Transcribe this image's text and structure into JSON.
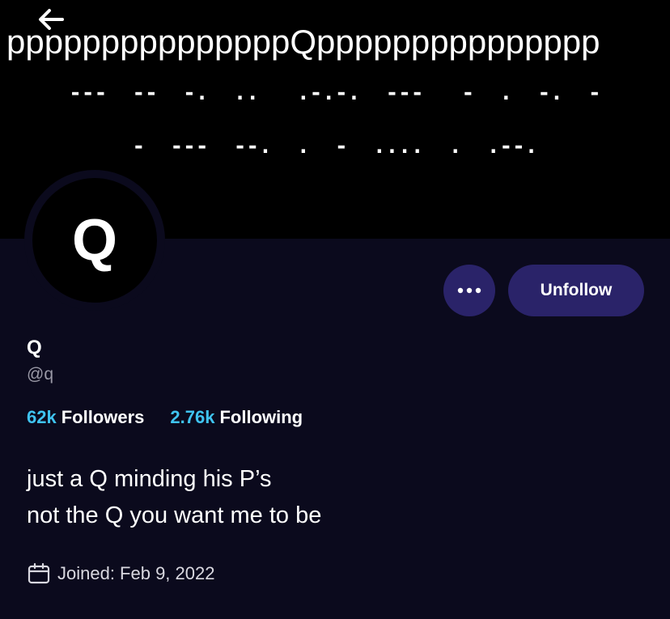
{
  "header": {
    "back_icon": "arrow-left-icon",
    "banner_text_line1": "pppppppppppppppQppppppppppppppp",
    "banner_text_line2": "---  --  -.  ..   .-.-.  ---   -  .  -.  -",
    "banner_text_line3": "-  ---  --.  .  -  ....  .  .--."
  },
  "profile": {
    "avatar_letter": "Q",
    "display_name": "Q",
    "handle": "@q",
    "followers_count": "62k",
    "followers_label": "Followers",
    "following_count": "2.76k",
    "following_label": "Following",
    "bio_line1": "just a Q minding his P’s",
    "bio_line2": "not the Q you want me to be",
    "joined": "Joined: Feb 9, 2022",
    "joined_icon": "calendar-icon"
  },
  "actions": {
    "more_icon": "more-horizontal-icon",
    "unfollow_label": "Unfollow"
  },
  "colors": {
    "background": "#0b0a1d",
    "banner": "#000000",
    "button": "#2a2369",
    "accent": "#3fc3f0",
    "muted": "#9a99a6"
  }
}
